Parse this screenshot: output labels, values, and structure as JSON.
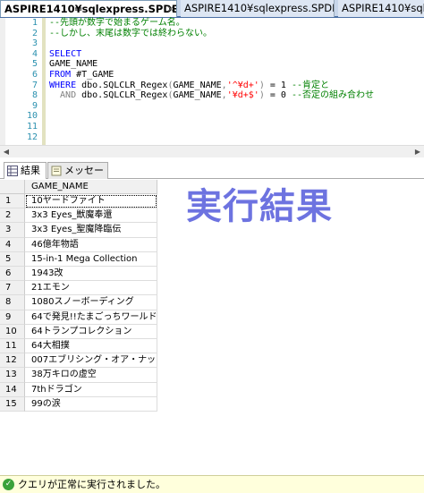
{
  "tabs": [
    {
      "label": "ASPIRE1410¥sqlexpress.SPDB*",
      "close": "×"
    },
    {
      "label": "ASPIRE1410¥sqlexpress.SPDB"
    },
    {
      "label": "ASPIRE1410¥sqlexpress.SPDB"
    }
  ],
  "editor": {
    "lines": [
      {
        "n": "1",
        "parts": [
          {
            "t": "--先頭が数字で始まるゲーム名。",
            "c": "cm"
          }
        ]
      },
      {
        "n": "2",
        "parts": [
          {
            "t": "--しかし、末尾は数字では終わらない。",
            "c": "cm"
          }
        ]
      },
      {
        "n": "3",
        "parts": []
      },
      {
        "n": "4",
        "parts": [
          {
            "t": "SELECT",
            "c": "kw"
          }
        ]
      },
      {
        "n": "5",
        "parts": [
          {
            "t": "GAME_NAME",
            "c": "id"
          }
        ]
      },
      {
        "n": "6",
        "parts": [
          {
            "t": "FROM ",
            "c": "kw"
          },
          {
            "t": "#T_GAME",
            "c": "id"
          }
        ]
      },
      {
        "n": "7",
        "parts": [
          {
            "t": "WHERE ",
            "c": "kw"
          },
          {
            "t": "dbo.SQLCLR_Regex",
            "c": "id"
          },
          {
            "t": "(",
            "c": "gr"
          },
          {
            "t": "GAME_NAME",
            "c": "id"
          },
          {
            "t": ",",
            "c": "gr"
          },
          {
            "t": "'^¥d+'",
            "c": "st"
          },
          {
            "t": ")",
            "c": "gr"
          },
          {
            "t": " = 1 ",
            "c": "id"
          },
          {
            "t": "--肯定と",
            "c": "cm"
          }
        ]
      },
      {
        "n": "8",
        "parts": [
          {
            "t": "  AND ",
            "c": "gr"
          },
          {
            "t": "dbo.SQLCLR_Regex",
            "c": "id"
          },
          {
            "t": "(",
            "c": "gr"
          },
          {
            "t": "GAME_NAME",
            "c": "id"
          },
          {
            "t": ",",
            "c": "gr"
          },
          {
            "t": "'¥d+$'",
            "c": "st"
          },
          {
            "t": ")",
            "c": "gr"
          },
          {
            "t": " = 0 ",
            "c": "id"
          },
          {
            "t": "--否定の組み合わせ",
            "c": "cm"
          }
        ]
      },
      {
        "n": "9",
        "parts": []
      },
      {
        "n": "10",
        "parts": []
      },
      {
        "n": "11",
        "parts": []
      },
      {
        "n": "12",
        "parts": []
      }
    ]
  },
  "result_tabs": {
    "results": "結果",
    "messages": "メッセージ"
  },
  "grid": {
    "column": "GAME_NAME",
    "rows": [
      {
        "n": "1",
        "v": "10ヤードファイト"
      },
      {
        "n": "2",
        "v": "3x3 Eyes_獣魔奉還"
      },
      {
        "n": "3",
        "v": "3x3 Eyes_聖魔降臨伝"
      },
      {
        "n": "4",
        "v": "46億年物語"
      },
      {
        "n": "5",
        "v": "15-in-1 Mega Collection"
      },
      {
        "n": "6",
        "v": "1943改"
      },
      {
        "n": "7",
        "v": "21エモン"
      },
      {
        "n": "8",
        "v": "1080スノーボーディング"
      },
      {
        "n": "9",
        "v": "64で発見!!たまごっちワールド"
      },
      {
        "n": "10",
        "v": "64トランプコレクション"
      },
      {
        "n": "11",
        "v": "64大相撲"
      },
      {
        "n": "12",
        "v": "007エブリシング・オア・ナッシング"
      },
      {
        "n": "13",
        "v": "38万キロの虚空"
      },
      {
        "n": "14",
        "v": "7thドラゴン"
      },
      {
        "n": "15",
        "v": "99の涙"
      }
    ]
  },
  "overlay_title": "実行結果",
  "status": {
    "icon": "check-circle-icon",
    "text": "クエリが正常に実行されました。"
  }
}
